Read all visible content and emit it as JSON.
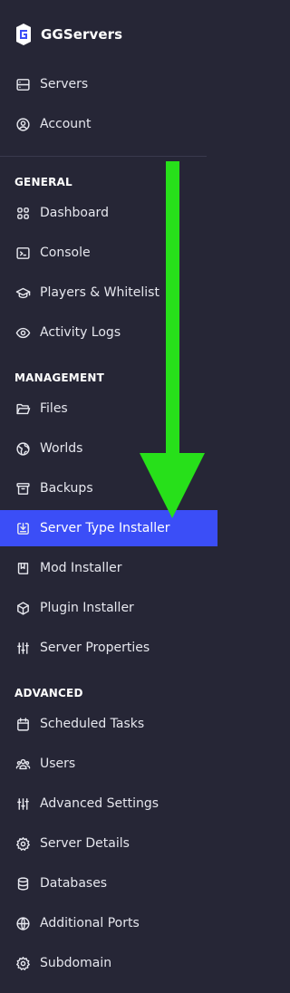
{
  "brand": {
    "name": "GGServers",
    "logo_icon": "gg-logo-icon",
    "accent_color": "#3b4ef7"
  },
  "top_nav": [
    {
      "label": "Servers",
      "icon": "server-icon"
    },
    {
      "label": "Account",
      "icon": "user-circle-icon"
    }
  ],
  "sections": {
    "general": "GENERAL",
    "management": "MANAGEMENT",
    "advanced": "ADVANCED"
  },
  "general_items": [
    {
      "label": "Dashboard",
      "icon": "grid-icon"
    },
    {
      "label": "Console",
      "icon": "terminal-icon"
    },
    {
      "label": "Players & Whitelist",
      "icon": "graduation-cap-icon"
    },
    {
      "label": "Activity Logs",
      "icon": "eye-icon"
    }
  ],
  "management_items": [
    {
      "label": "Files",
      "icon": "folder-icon"
    },
    {
      "label": "Worlds",
      "icon": "globe-icon"
    },
    {
      "label": "Backups",
      "icon": "archive-icon"
    },
    {
      "label": "Server Type Installer",
      "icon": "download-box-icon",
      "active": true
    },
    {
      "label": "Mod Installer",
      "icon": "book-icon"
    },
    {
      "label": "Plugin Installer",
      "icon": "cube-icon"
    },
    {
      "label": "Server Properties",
      "icon": "sliders-icon"
    }
  ],
  "advanced_items": [
    {
      "label": "Scheduled Tasks",
      "icon": "calendar-icon"
    },
    {
      "label": "Users",
      "icon": "users-icon"
    },
    {
      "label": "Advanced Settings",
      "icon": "sliders-icon"
    },
    {
      "label": "Server Details",
      "icon": "gear-icon"
    },
    {
      "label": "Databases",
      "icon": "database-icon"
    },
    {
      "label": "Additional Ports",
      "icon": "globe-icon"
    },
    {
      "label": "Subdomain",
      "icon": "gear-icon"
    }
  ],
  "annotation": {
    "arrow_color": "#27e01a",
    "arrow_direction": "down"
  }
}
